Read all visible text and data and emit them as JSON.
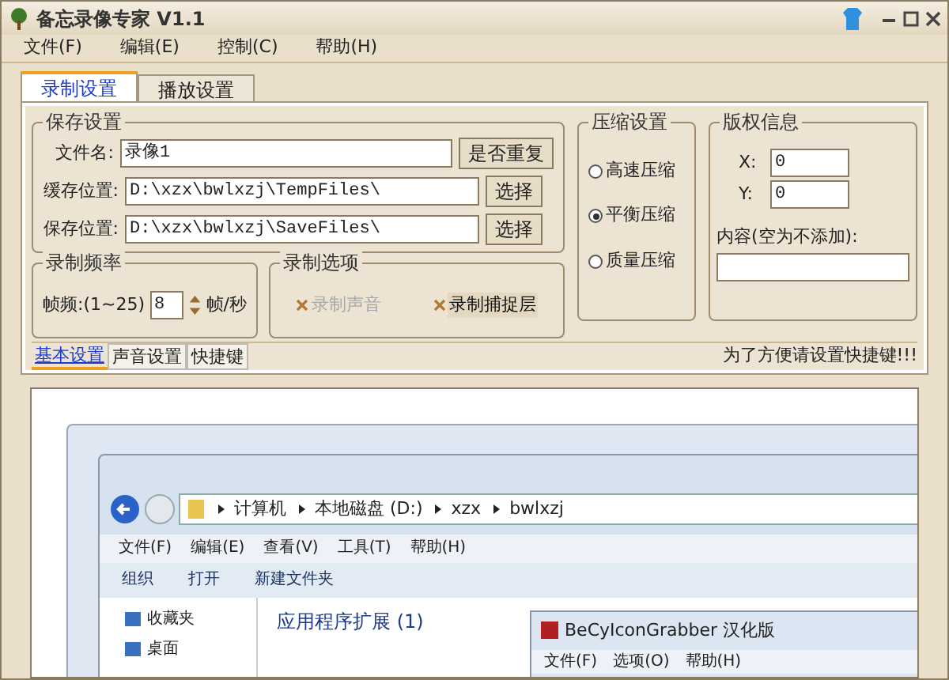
{
  "window": {
    "title": "备忘录像专家 V1.1"
  },
  "menu": [
    "文件(F)",
    "编辑(E)",
    "控制(C)",
    "帮助(H)"
  ],
  "tabs": [
    {
      "label": "录制设置",
      "selected": true
    },
    {
      "label": "播放设置",
      "selected": false
    }
  ],
  "save_settings": {
    "title": "保存设置",
    "fields": [
      {
        "label": "文件名:",
        "value": "录像1",
        "button": "是否重复"
      },
      {
        "label": "缓存位置:",
        "value": "D:\\xzx\\bwlxzj\\TempFiles\\",
        "button": "选择"
      },
      {
        "label": "保存位置:",
        "value": "D:\\xzx\\bwlxzj\\SaveFiles\\",
        "button": "选择"
      }
    ]
  },
  "compression": {
    "title": "压缩设置",
    "options": [
      {
        "label": "高速压缩",
        "selected": false
      },
      {
        "label": "平衡压缩",
        "selected": true
      },
      {
        "label": "质量压缩",
        "selected": false
      }
    ]
  },
  "copyright": {
    "title": "版权信息",
    "x_label": "X:",
    "x_value": "0",
    "y_label": "Y:",
    "y_value": "0",
    "content_label": "内容(空为不添加):"
  },
  "frequency": {
    "title": "录制频率",
    "label": "帧频:(1~25)",
    "value": "8",
    "unit": "帧/秒"
  },
  "record_options": {
    "title": "录制选项",
    "options": [
      {
        "label": "录制声音",
        "disabled": true
      },
      {
        "label": "录制捕捉层",
        "disabled": false
      }
    ]
  },
  "bottom_tabs": [
    {
      "label": "基本设置",
      "selected": true
    },
    {
      "label": "声音设置",
      "selected": false
    },
    {
      "label": "快捷键",
      "selected": false
    }
  ],
  "hint": "为了方便请设置快捷键!!!",
  "preview": {
    "breadcrumb": [
      "计算机",
      "本地磁盘 (D:)",
      "xzx",
      "bwlxzj"
    ],
    "menu": [
      "文件(F)",
      "编辑(E)",
      "查看(V)",
      "工具(T)",
      "帮助(H)"
    ],
    "toolbar": [
      "组织",
      "打开",
      "新建文件夹"
    ],
    "nav": [
      "收藏夹",
      "桌面"
    ],
    "group_header": "应用程序扩展 (1)",
    "dialog": {
      "title": "BeCyIconGrabber 汉化版",
      "menu": [
        "文件(F)",
        "选项(O)",
        "帮助(H)"
      ]
    }
  }
}
